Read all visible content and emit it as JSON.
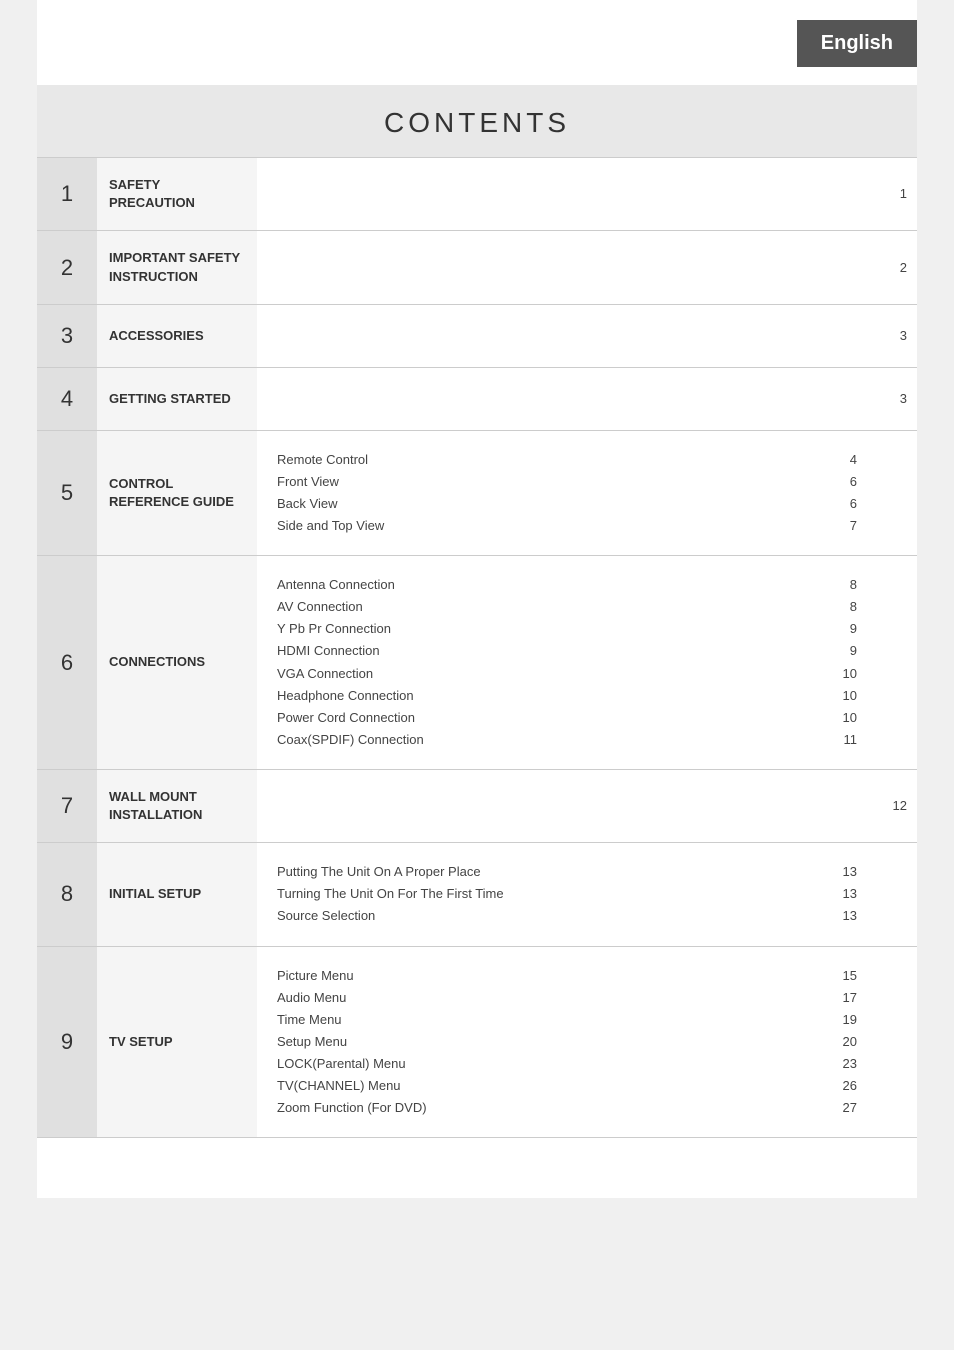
{
  "header": {
    "language": "English"
  },
  "contents_title": "CONTENTS",
  "rows": [
    {
      "num": "1",
      "title": "SAFETY PRECAUTION",
      "sub_items": [],
      "sub_pages": [],
      "page": "1"
    },
    {
      "num": "2",
      "title": "IMPORTANT SAFETY INSTRUCTION",
      "sub_items": [],
      "sub_pages": [],
      "page": "2"
    },
    {
      "num": "3",
      "title": "ACCESSORIES",
      "sub_items": [],
      "sub_pages": [],
      "page": "3"
    },
    {
      "num": "4",
      "title": "GETTING STARTED",
      "sub_items": [],
      "sub_pages": [],
      "page": "3"
    },
    {
      "num": "5",
      "title": "CONTROL REFERENCE GUIDE",
      "sub_items": [
        "Remote Control",
        "Front View",
        "Back View",
        "Side and Top View"
      ],
      "sub_pages": [
        "4",
        "6",
        "6",
        "7"
      ],
      "page": ""
    },
    {
      "num": "6",
      "title": "CONNECTIONS",
      "sub_items": [
        "Antenna Connection",
        "AV Connection",
        "Y Pb Pr Connection",
        "HDMI Connection",
        "VGA Connection",
        "Headphone Connection",
        "Power Cord Connection",
        "Coax(SPDIF) Connection"
      ],
      "sub_pages": [
        "8",
        "8",
        "9",
        "9",
        "10",
        "10",
        "10",
        "11"
      ],
      "page": ""
    },
    {
      "num": "7",
      "title": "WALL MOUNT INSTALLATION",
      "sub_items": [],
      "sub_pages": [],
      "page": "12"
    },
    {
      "num": "8",
      "title": "INITIAL SETUP",
      "sub_items": [
        "Putting The Unit On A Proper Place",
        "Turning The Unit On For The First Time",
        "Source Selection"
      ],
      "sub_pages": [
        "13",
        "13",
        "13"
      ],
      "page": ""
    },
    {
      "num": "9",
      "title": "TV SETUP",
      "sub_items": [
        "Picture Menu",
        "Audio Menu",
        "Time Menu",
        "Setup Menu",
        "LOCK(Parental) Menu",
        "TV(CHANNEL) Menu",
        "Zoom Function  (For  DVD)"
      ],
      "sub_pages": [
        "15",
        "17",
        "19",
        "20",
        "23",
        "26",
        "27"
      ],
      "page": ""
    }
  ]
}
